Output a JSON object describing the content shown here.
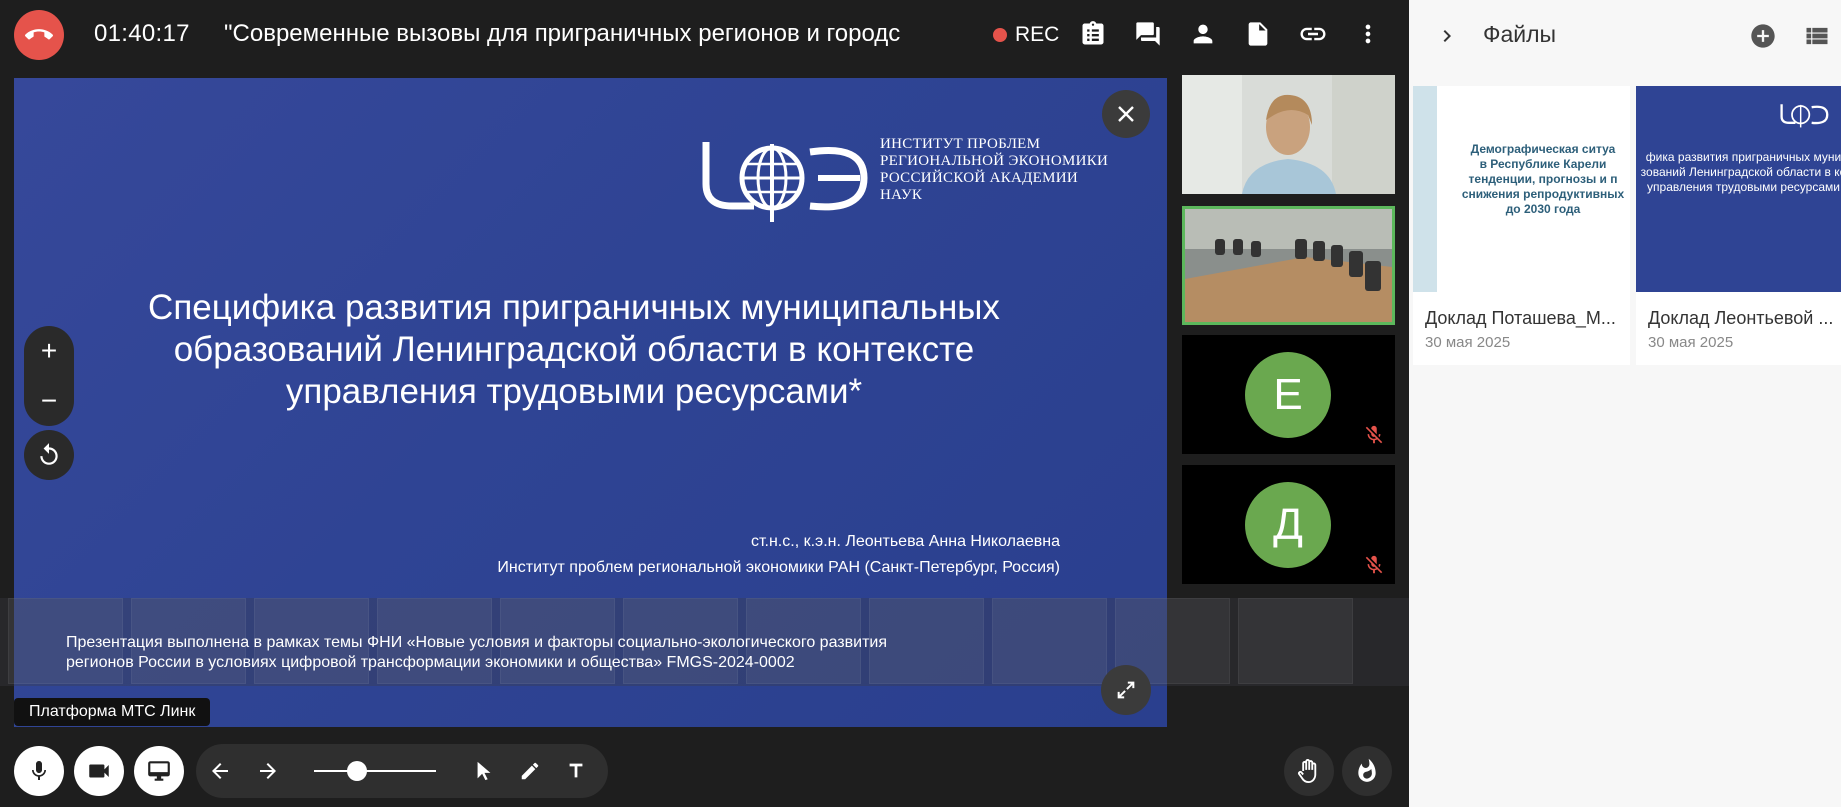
{
  "call": {
    "timer": "01:40:17",
    "title": "\"Современные вызовы для приграничных регионов и городс",
    "rec_label": "REC"
  },
  "slide": {
    "institute_lines": [
      "ИНСТИТУТ ПРОБЛЕМ",
      "РЕГИОНАЛЬНОЙ ЭКОНОМИКИ",
      "РОССИЙСКОЙ АКАДЕМИИ",
      "НАУК"
    ],
    "title_lines": [
      "Специфика развития приграничных муниципальных",
      "образований Ленинградской области в контексте",
      "управления трудовыми ресурсами*"
    ],
    "author_line1": "ст.н.с., к.э.н. Леонтьева Анна Николаевна",
    "author_line2": "Институт проблем региональной экономики РАН (Санкт-Петербург, Россия)",
    "footnote_line1": "Презентация выполнена в рамках темы ФНИ «Новые условия и факторы социально-экологического развития",
    "footnote_line2": "регионов России в условиях цифровой трансформации экономики и общества» FMGS-2024-0002",
    "zoom_in": "+",
    "zoom_out": "−"
  },
  "platform_label": "Платформа МТС Линк",
  "participants": [
    {
      "type": "video",
      "name": "participant-woman-video"
    },
    {
      "type": "video",
      "name": "participant-room-video",
      "active": true
    },
    {
      "type": "avatar",
      "letter": "Е",
      "muted": true
    },
    {
      "type": "avatar",
      "letter": "Д",
      "muted": true
    }
  ],
  "slider": {
    "value": 0.35
  },
  "files_panel": {
    "title": "Файлы",
    "files": [
      {
        "name": "Доклад Поташева_М...",
        "date": "30 мая 2025",
        "preview_lines": [
          "Демографическая ситуа",
          "в Республике Карели",
          "тенденции, прогнозы и п",
          "снижения репродуктивных",
          "до 2030 года"
        ]
      },
      {
        "name": "Доклад Леонтьевой ...",
        "date": "30 мая 2025",
        "preview_lines": [
          "фика развития приграничных муни",
          "зований Ленинградской области в ко",
          "управления трудовыми ресурсами"
        ]
      }
    ]
  },
  "colors": {
    "hangup": "#e5534b",
    "slide_bg": "#2f4494",
    "avatar_green": "#6aa84f",
    "active_border": "#5cb85c"
  }
}
